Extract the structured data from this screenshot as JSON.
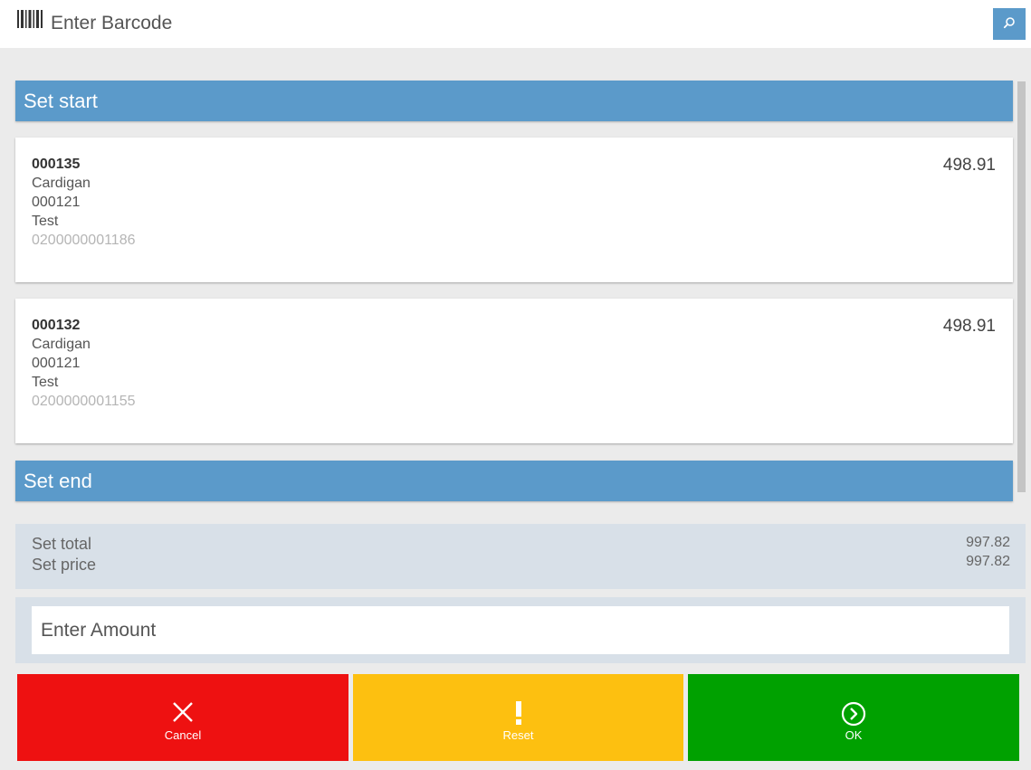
{
  "topbar": {
    "barcode_placeholder": "Enter Barcode",
    "barcode_icon": "barcode-icon",
    "search_icon": "search-icon"
  },
  "sections": {
    "start_label": "Set start",
    "end_label": "Set end"
  },
  "items": [
    {
      "code": "000135",
      "name": "Cardigan",
      "ref": "000121",
      "variant": "Test",
      "barcode": "0200000001186",
      "price": "498.91"
    },
    {
      "code": "000132",
      "name": "Cardigan",
      "ref": "000121",
      "variant": "Test",
      "barcode": "0200000001155",
      "price": "498.91"
    }
  ],
  "totals": {
    "set_total_label": "Set total",
    "set_total_value": "997.82",
    "set_price_label": "Set price",
    "set_price_value": "997.82"
  },
  "amount": {
    "placeholder": "Enter Amount"
  },
  "actions": {
    "cancel_label": "Cancel",
    "reset_label": "Reset",
    "ok_label": "OK"
  },
  "colors": {
    "accent": "#5b9aca",
    "cancel": "#ee1111",
    "reset": "#fdc010",
    "ok": "#00a100",
    "totals_bg": "#d8e0e8"
  }
}
